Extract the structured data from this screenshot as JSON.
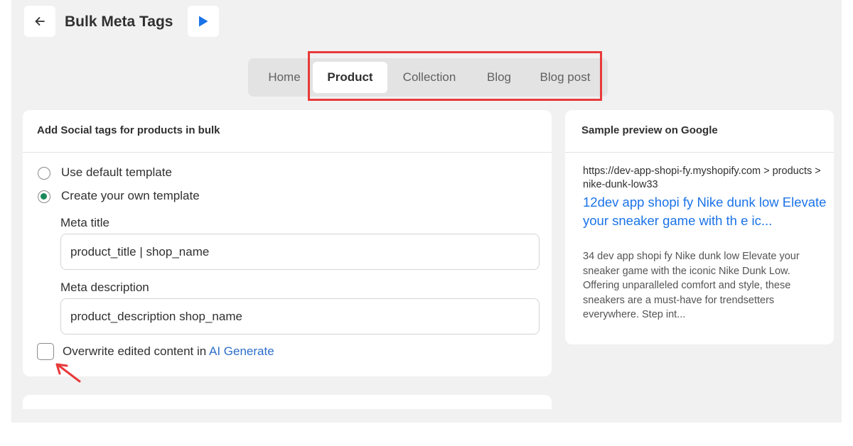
{
  "header": {
    "title": "Bulk Meta Tags",
    "back_icon": "arrow-left-icon",
    "play_icon": "play-icon",
    "accent_color": "#1a73e8"
  },
  "tabs": [
    {
      "label": "Home",
      "active": false
    },
    {
      "label": "Product",
      "active": true
    },
    {
      "label": "Collection",
      "active": false
    },
    {
      "label": "Blog",
      "active": false
    },
    {
      "label": "Blog post",
      "active": false
    }
  ],
  "social_card": {
    "title": "Add Social tags for products in bulk",
    "options": [
      {
        "label": "Use default template",
        "checked": false
      },
      {
        "label": "Create your own template",
        "checked": true
      }
    ],
    "meta_title_label": "Meta title",
    "meta_title_value": "product_title | shop_name",
    "meta_description_label": "Meta description",
    "meta_description_value": "product_description shop_name",
    "overwrite_label": "Overwrite edited content in",
    "overwrite_link": "AI Generate",
    "overwrite_checked": false
  },
  "preview_card": {
    "title": "Sample preview on Google",
    "url": "https://dev-app-shopi-fy.myshopify.com > products > nike-dunk-low33",
    "headline": "12dev app shopi fy Nike dunk low Elevate your sneaker game with th e ic...",
    "description": "34 dev app shopi fy Nike dunk low Elevate your sneaker game with the iconic Nike Dunk Low. Offering unparalleled comfort and style, these sneakers are a must-have for trendsetters everywhere. Step int..."
  },
  "annotation_color": "#e83a3a"
}
